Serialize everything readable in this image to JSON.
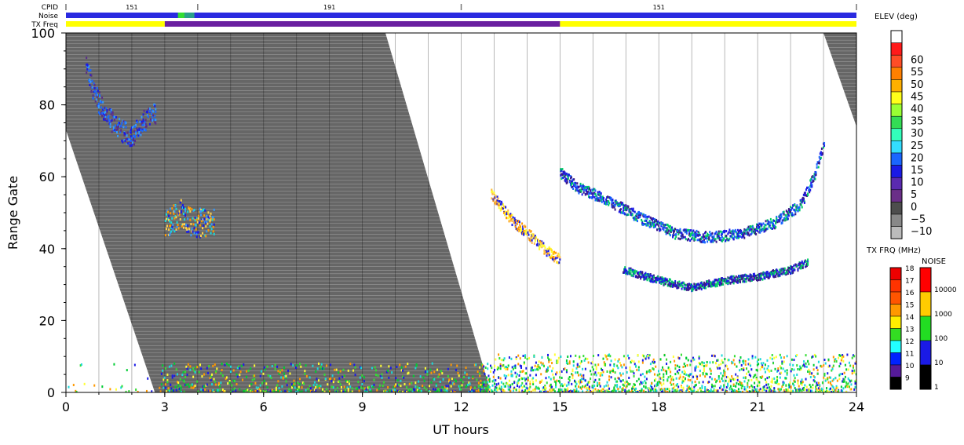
{
  "header": {
    "cpid_label": "CPID",
    "noise_label": "Noise",
    "txfreq_label": "TX Freq",
    "cpid_segments": [
      {
        "start": 0,
        "end": 4,
        "label": "151"
      },
      {
        "start": 4,
        "end": 12,
        "label": "191"
      },
      {
        "start": 12,
        "end": 24,
        "label": "151"
      }
    ],
    "noise_bar": {
      "default_color": "#2a2ae0",
      "segments": [
        {
          "start": 3.4,
          "end": 3.6,
          "color": "#33dd33"
        },
        {
          "start": 3.6,
          "end": 3.9,
          "color": "#2aa08a"
        }
      ]
    },
    "txfreq_bar": {
      "segments": [
        {
          "start": 0,
          "end": 3,
          "color": "#ffff00"
        },
        {
          "start": 3,
          "end": 15,
          "color": "#6a1fa0"
        },
        {
          "start": 15,
          "end": 24,
          "color": "#ffff00"
        }
      ]
    }
  },
  "chart_data": {
    "type": "heatmap",
    "title": "",
    "xlabel": "UT hours",
    "ylabel": "Range Gate",
    "xlim": [
      0,
      24
    ],
    "ylim": [
      0,
      100
    ],
    "x_ticks": [
      0,
      3,
      6,
      9,
      12,
      15,
      18,
      21,
      24
    ],
    "y_ticks": [
      0,
      20,
      40,
      60,
      80,
      100
    ],
    "ground_scatter_color": "#666666",
    "ground_scatter_regions": [
      {
        "name": "main",
        "polygon": [
          [
            0,
            100
          ],
          [
            9.7,
            100
          ],
          [
            12.9,
            0
          ],
          [
            2.7,
            0
          ],
          [
            0,
            73
          ]
        ]
      },
      {
        "name": "late",
        "polygon": [
          [
            23.0,
            100
          ],
          [
            24.0,
            100
          ],
          [
            24.0,
            74
          ]
        ]
      }
    ],
    "echo_features": [
      {
        "name": "early high-range echo",
        "x_start": 0.6,
        "x_end": 2.7,
        "points": [
          [
            0.6,
            90
          ],
          [
            0.9,
            82
          ],
          [
            1.2,
            77
          ],
          [
            1.6,
            73
          ],
          [
            2.0,
            71
          ],
          [
            2.3,
            75
          ],
          [
            2.6,
            77
          ]
        ],
        "thickness": 6,
        "colors": [
          "#1a1ae6",
          "#1a66ff",
          "#5a2e8a",
          "#3399ff"
        ]
      },
      {
        "name": "3 UT echo",
        "x_start": 3.0,
        "x_end": 4.5,
        "points": [
          [
            3.0,
            46
          ],
          [
            3.2,
            48
          ],
          [
            3.5,
            50
          ],
          [
            3.8,
            47
          ],
          [
            4.2,
            47
          ],
          [
            4.5,
            48
          ]
        ],
        "thickness": 8,
        "colors": [
          "#1a1ae6",
          "#ff9900",
          "#ffd24d",
          "#3399ff",
          "#1ad9d9"
        ]
      },
      {
        "name": "descending echo",
        "x_start": 12.9,
        "x_end": 15.0,
        "points": [
          [
            12.9,
            55
          ],
          [
            13.5,
            48
          ],
          [
            14.0,
            44
          ],
          [
            14.5,
            40
          ],
          [
            14.9,
            37
          ]
        ],
        "thickness": 3,
        "colors": [
          "#ff9900",
          "#ffff33",
          "#ffb84d",
          "#1a1ae6"
        ]
      },
      {
        "name": "U-shaped echo",
        "x_start": 15.0,
        "x_end": 23.0,
        "points": [
          [
            15.0,
            61
          ],
          [
            15.5,
            57
          ],
          [
            16.5,
            53
          ],
          [
            17.5,
            48
          ],
          [
            18.5,
            44
          ],
          [
            19.5,
            43
          ],
          [
            20.5,
            44
          ],
          [
            21.5,
            47
          ],
          [
            22.3,
            52
          ],
          [
            22.7,
            60
          ],
          [
            23.0,
            69
          ]
        ],
        "thickness": 3,
        "colors": [
          "#1a1ae6",
          "#3b1a8a",
          "#1a66ff",
          "#00cc66"
        ]
      },
      {
        "name": "lower arc echo",
        "x_start": 16.9,
        "x_end": 22.5,
        "points": [
          [
            16.9,
            34
          ],
          [
            18.0,
            31
          ],
          [
            19.0,
            29
          ],
          [
            20.0,
            31
          ],
          [
            21.0,
            32
          ],
          [
            22.0,
            34
          ],
          [
            22.5,
            36
          ]
        ],
        "thickness": 2,
        "colors": [
          "#1a1ae6",
          "#3b1a8a",
          "#00cc66"
        ]
      }
    ],
    "near_range_band": {
      "x_start": 0,
      "x_end": 24,
      "y_max": 8,
      "colors": [
        "#00cc33",
        "#33dd33",
        "#1ad9d9",
        "#1a1ae6",
        "#ffff33",
        "#ff9900"
      ]
    }
  },
  "elev_scale": {
    "title": "ELEV (deg)",
    "entries": [
      {
        "label": "",
        "color": "#ffffff"
      },
      {
        "label": "60",
        "color": "#ff1a1a"
      },
      {
        "label": "55",
        "color": "#ff4d26"
      },
      {
        "label": "50",
        "color": "#ff8000"
      },
      {
        "label": "45",
        "color": "#ffb000"
      },
      {
        "label": "40",
        "color": "#ffff1a"
      },
      {
        "label": "35",
        "color": "#99ff33"
      },
      {
        "label": "30",
        "color": "#33dd55"
      },
      {
        "label": "25",
        "color": "#33ffbb"
      },
      {
        "label": "20",
        "color": "#33ddff"
      },
      {
        "label": "15",
        "color": "#1a66ff"
      },
      {
        "label": "10",
        "color": "#1a1ae6"
      },
      {
        "label": "5",
        "color": "#5a2ab0"
      },
      {
        "label": "0",
        "color": "#6a2f88"
      },
      {
        "label": "−5",
        "color": "#4d4d4d"
      },
      {
        "label": "−10",
        "color": "#888888"
      },
      {
        "label": "",
        "color": "#bbbbbb"
      }
    ]
  },
  "txfreq_scale": {
    "title": "TX FRQ (MHz)",
    "entries": [
      {
        "label": "18",
        "color": "#ee0000"
      },
      {
        "label": "17",
        "color": "#ff3300"
      },
      {
        "label": "16",
        "color": "#ff5500"
      },
      {
        "label": "15",
        "color": "#ff9900"
      },
      {
        "label": "14",
        "color": "#ffee00"
      },
      {
        "label": "13",
        "color": "#33dd22"
      },
      {
        "label": "12",
        "color": "#22ffff"
      },
      {
        "label": "11",
        "color": "#0022ff"
      },
      {
        "label": "10",
        "color": "#551a99"
      },
      {
        "label": "9",
        "color": "#000000"
      }
    ]
  },
  "noise_scale": {
    "title": "NOISE",
    "entries": [
      {
        "label": "10000",
        "color": "#ff0000"
      },
      {
        "label": "1000",
        "color": "#ffcc00"
      },
      {
        "label": "100",
        "color": "#22dd22"
      },
      {
        "label": "10",
        "color": "#1a1ae6"
      },
      {
        "label": "1",
        "color": "#000000"
      }
    ]
  }
}
